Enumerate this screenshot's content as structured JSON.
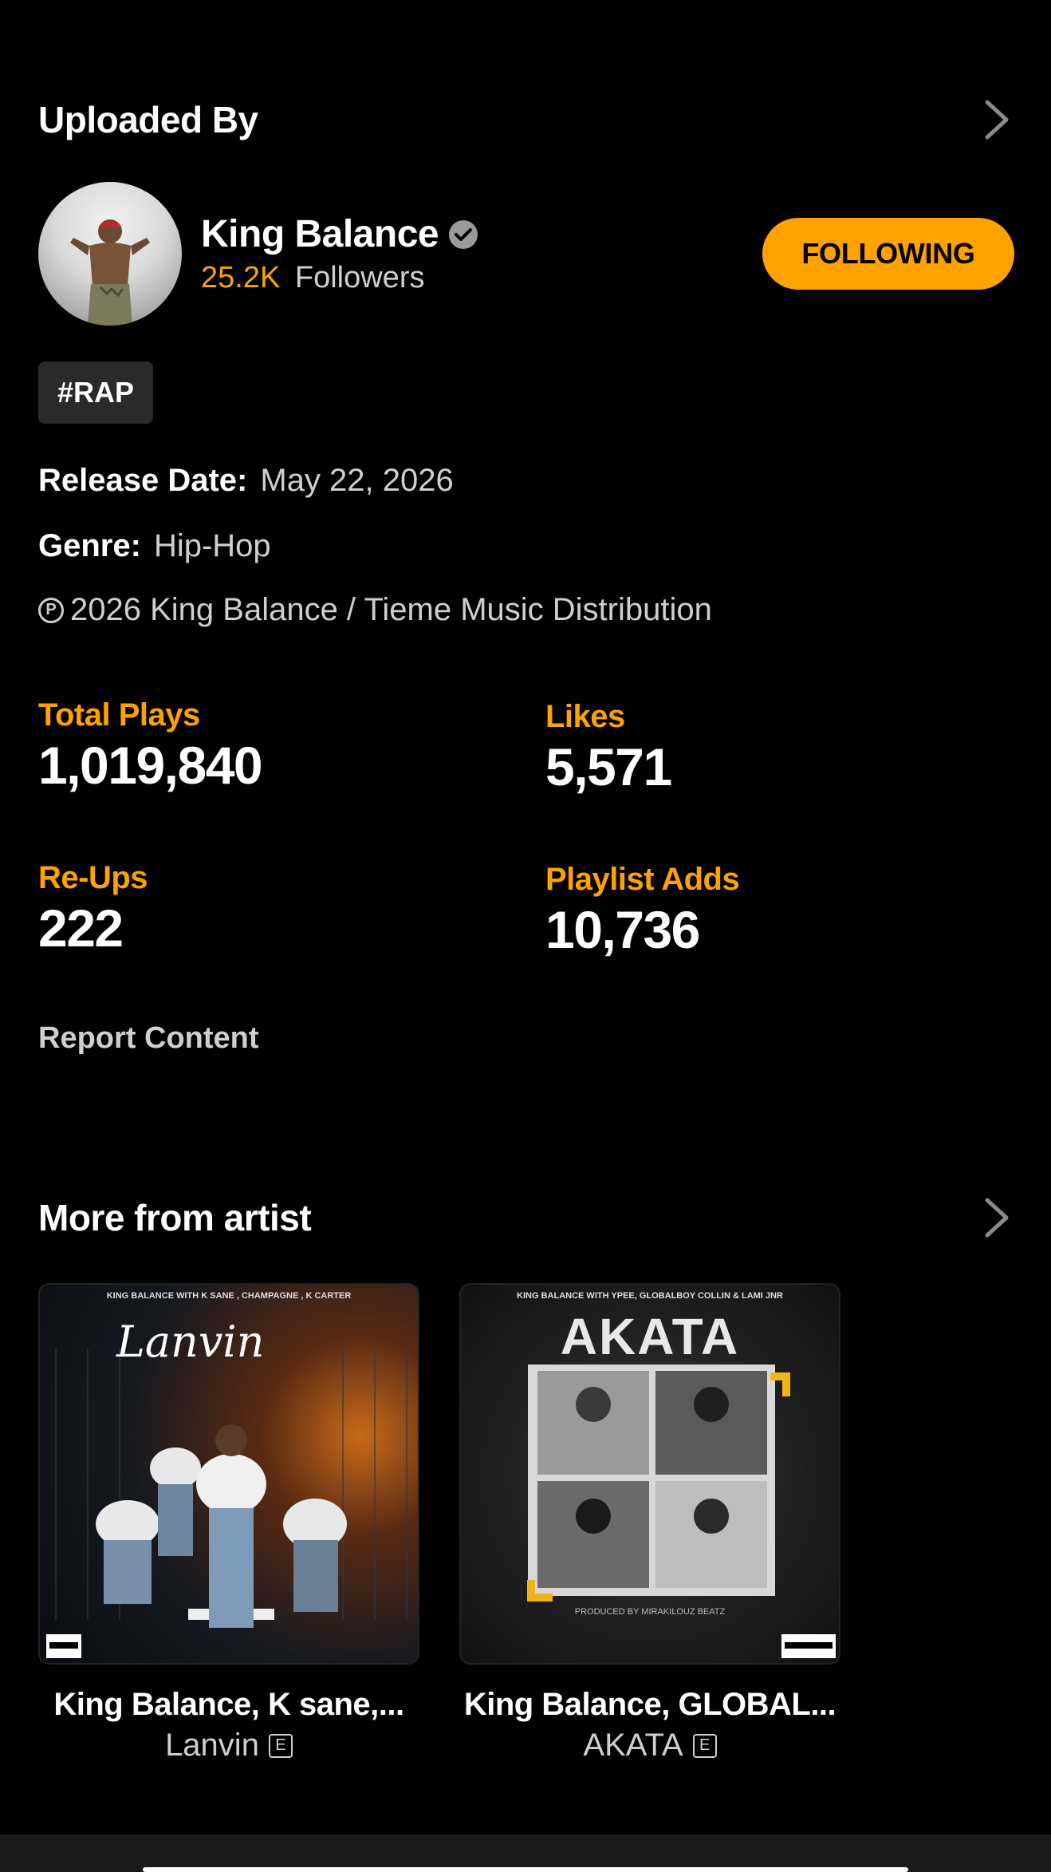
{
  "uploaded_by": {
    "title": "Uploaded By",
    "artist_name": "King Balance",
    "followers_count": "25.2K",
    "followers_label": "Followers",
    "follow_button": "FOLLOWING"
  },
  "tag": "#RAP",
  "release_date": {
    "label": "Release Date:",
    "value": "May 22, 2026"
  },
  "genre": {
    "label": "Genre:",
    "value": "Hip-Hop"
  },
  "copyright": {
    "symbol": "P",
    "text": "2026 King Balance / Tieme Music Distribution"
  },
  "stats": {
    "total_plays": {
      "label": "Total Plays",
      "value": "1,019,840"
    },
    "likes": {
      "label": "Likes",
      "value": "5,571"
    },
    "re_ups": {
      "label": "Re-Ups",
      "value": "222"
    },
    "playlist_adds": {
      "label": "Playlist Adds",
      "value": "10,736"
    }
  },
  "report_content": "Report Content",
  "more_from_artist": {
    "title": "More from artist",
    "albums": [
      {
        "artist": "King Balance, K sane,...",
        "title": "Lanvin",
        "explicit": "E",
        "cover_header": "KING BALANCE WITH K SANE , CHAMPAGNE , K CARTER",
        "cover_title": "Lanvin"
      },
      {
        "artist": "King Balance, GLOBAL...",
        "title": "AKATA",
        "explicit": "E",
        "cover_header": "KING BALANCE WITH YPEE, GLOBALBOY COLLIN & LAMI JNR",
        "cover_title": "AKATA",
        "cover_footer": "PRODUCED BY MIRAKILOUZ BEATZ"
      }
    ]
  },
  "colors": {
    "accent": "#ffa200",
    "background": "#000000",
    "muted_text": "#cfcfcf",
    "tag_bg": "#2a2a2a"
  }
}
